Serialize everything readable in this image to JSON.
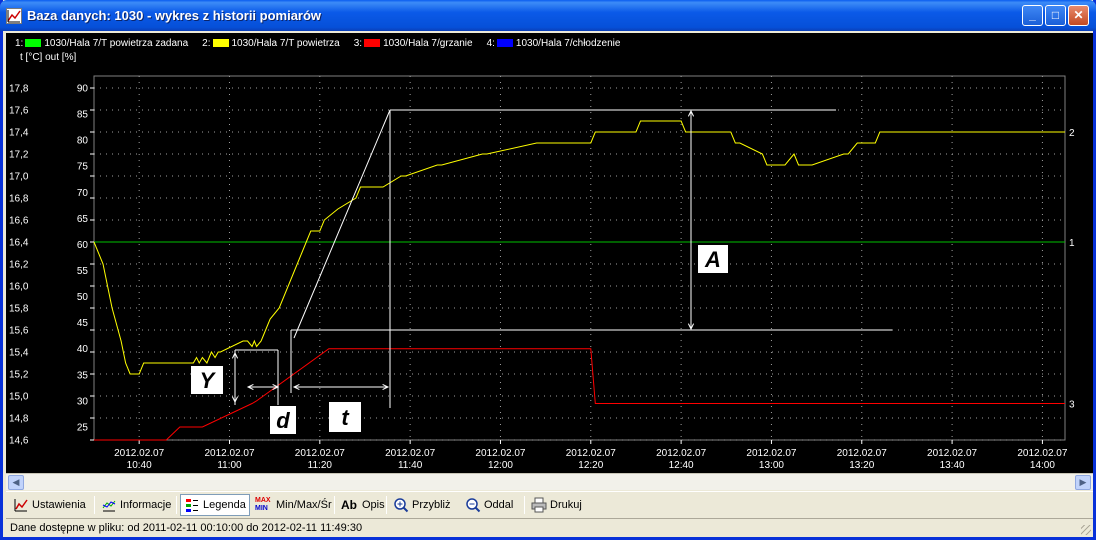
{
  "window": {
    "title": "Baza danych: 1030 - wykres z historii pomiarów",
    "minimize_glyph": "_",
    "maximize_glyph": "□",
    "close_glyph": "✕"
  },
  "legend": [
    {
      "num": "1:",
      "label": "1030/Hala 7/T powietrza zadana",
      "color": "#00ff00"
    },
    {
      "num": "2:",
      "label": "1030/Hala 7/T powietrza",
      "color": "#ffff00"
    },
    {
      "num": "3:",
      "label": "1030/Hala 7/grzanie",
      "color": "#ff0000"
    },
    {
      "num": "4:",
      "label": "1030/Hala 7/chłodzenie",
      "color": "#0000ff"
    }
  ],
  "axis_units": "t [°C]   out [%]",
  "chart_data": {
    "type": "line",
    "x_ticks": [
      {
        "date": "2012.02.07",
        "time": "10:40"
      },
      {
        "date": "2012.02.07",
        "time": "11:00"
      },
      {
        "date": "2012.02.07",
        "time": "11:20"
      },
      {
        "date": "2012.02.07",
        "time": "11:40"
      },
      {
        "date": "2012.02.07",
        "time": "12:00"
      },
      {
        "date": "2012.02.07",
        "time": "12:20"
      },
      {
        "date": "2012.02.07",
        "time": "12:40"
      },
      {
        "date": "2012.02.07",
        "time": "13:00"
      },
      {
        "date": "2012.02.07",
        "time": "13:20"
      },
      {
        "date": "2012.02.07",
        "time": "13:40"
      },
      {
        "date": "2012.02.07",
        "time": "14:00"
      }
    ],
    "x_range_minutes": [
      630,
      845
    ],
    "y_left_ticks": [
      "17,8",
      "17,6",
      "17,4",
      "17,2",
      "17,0",
      "16,8",
      "16,6",
      "16,4",
      "16,2",
      "16,0",
      "15,8",
      "15,6",
      "15,4",
      "15,2",
      "15,0",
      "14,8",
      "14,6"
    ],
    "y_left_range": [
      14.6,
      17.8
    ],
    "y_right_ticks": [
      "90",
      "85",
      "80",
      "75",
      "70",
      "65",
      "60",
      "55",
      "50",
      "45",
      "40",
      "35",
      "30",
      "25"
    ],
    "y_right_range": [
      22.5,
      90
    ],
    "series": [
      {
        "name": "1030/Hala 7/T powietrza zadana",
        "color": "#00c000",
        "axis": "left",
        "x": [
          630,
          845
        ],
        "y": [
          16.4,
          16.4
        ],
        "end_label": "1"
      },
      {
        "name": "1030/Hala 7/T powietrza",
        "color": "#ffff00",
        "axis": "left",
        "x": [
          630,
          632,
          634,
          636,
          637,
          638,
          640,
          641,
          643,
          652,
          652.7,
          653.3,
          654,
          655,
          656,
          656.8,
          657.5,
          658,
          663,
          664,
          665,
          665.5,
          666,
          667,
          667.5,
          668,
          668.5,
          669,
          670,
          671,
          672,
          673,
          674,
          675,
          676,
          677,
          678,
          680,
          681,
          684,
          688,
          689,
          694,
          698,
          699,
          706,
          707,
          716,
          717,
          728,
          729,
          740,
          741,
          750,
          751,
          760,
          761,
          771,
          772,
          773,
          778,
          779,
          782,
          783,
          785,
          786,
          787,
          788,
          789,
          796,
          797,
          799,
          803,
          804,
          807,
          808,
          810,
          811,
          813,
          814,
          845
        ],
        "y": [
          16.4,
          16.2,
          15.8,
          15.5,
          15.3,
          15.2,
          15.2,
          15.3,
          15.3,
          15.3,
          15.35,
          15.3,
          15.35,
          15.3,
          15.4,
          15.35,
          15.4,
          15.4,
          15.5,
          15.5,
          15.45,
          15.5,
          15.45,
          15.5,
          15.55,
          15.6,
          15.65,
          15.7,
          15.75,
          15.8,
          15.9,
          16.0,
          16.1,
          16.2,
          16.3,
          16.4,
          16.5,
          16.5,
          16.6,
          16.7,
          16.8,
          16.9,
          16.9,
          17.0,
          17.0,
          17.1,
          17.1,
          17.2,
          17.2,
          17.3,
          17.3,
          17.3,
          17.4,
          17.4,
          17.5,
          17.5,
          17.4,
          17.4,
          17.3,
          17.3,
          17.2,
          17.1,
          17.1,
          17.1,
          17.2,
          17.1,
          17.1,
          17.1,
          17.1,
          17.2,
          17.2,
          17.3,
          17.3,
          17.4,
          17.4,
          17.4,
          17.4,
          17.4,
          17.4,
          17.4,
          17.4
        ],
        "end_label": "2"
      },
      {
        "name": "1030/Hala 7/grzanie",
        "color": "#ff0000",
        "axis": "right",
        "x": [
          630,
          646,
          649,
          654,
          665,
          666,
          682,
          690,
          740,
          741,
          845
        ],
        "y": [
          22.5,
          22.5,
          25,
          25,
          29.5,
          30,
          40,
          40,
          40,
          29.5,
          29.5
        ],
        "end_label": "3"
      },
      {
        "name": "1030/Hala 7/chłodzenie",
        "color": "#0000ff",
        "axis": "right",
        "x": [],
        "y": []
      }
    ],
    "annotations": [
      "Y",
      "d",
      "t",
      "A"
    ],
    "grid": true
  },
  "toolbar": [
    {
      "label": "Ustawienia",
      "icon": "chart-settings-icon"
    },
    {
      "label": "Informacje",
      "icon": "info-icon"
    },
    {
      "label": "Legenda",
      "icon": "legend-icon",
      "active": true
    },
    {
      "label": "Min/Max/Śr",
      "icon": "minmax-icon",
      "icon_text_top": "MAX",
      "icon_text_bottom": "MIN"
    },
    {
      "label": "Opis",
      "icon": "text-icon",
      "icon_text": "Ab"
    },
    {
      "label": "Przybliż",
      "icon": "zoom-in-icon"
    },
    {
      "label": "Oddal",
      "icon": "zoom-out-icon"
    },
    {
      "label": "Drukuj",
      "icon": "printer-icon"
    }
  ],
  "status": "Dane dostępne w pliku: od 2011-02-11 00:10:00 do 2012-02-11 11:49:30",
  "scroll": {
    "left_glyph": "◀",
    "right_glyph": "▶"
  }
}
